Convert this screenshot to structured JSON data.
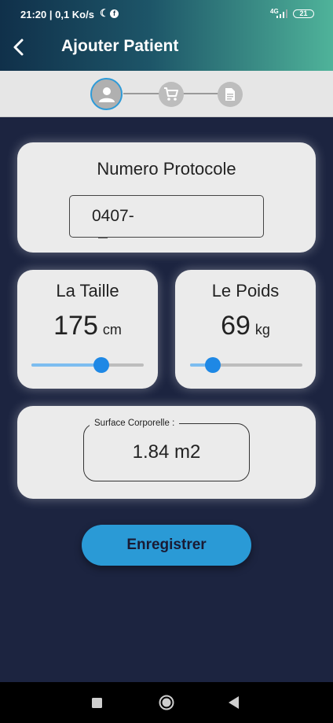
{
  "status_bar": {
    "time_and_speed": "21:20 | 0,1 Ko/s",
    "network": "4G",
    "battery": "21"
  },
  "app_bar": {
    "title": "Ajouter Patient",
    "back_icon": "arrow-back-icon"
  },
  "stepper": {
    "steps": [
      {
        "icon": "person-icon",
        "active": true
      },
      {
        "icon": "cart-icon",
        "active": false
      },
      {
        "icon": "document-icon",
        "active": false
      }
    ]
  },
  "protocol": {
    "title": "Numero Protocole",
    "value": "0407-"
  },
  "height": {
    "title": "La Taille",
    "value": "175",
    "unit": "cm",
    "slider_fraction": 0.62
  },
  "weight": {
    "title": "Le Poids",
    "value": "69",
    "unit": "kg",
    "slider_fraction": 0.2
  },
  "surface": {
    "label": "Surface Corporelle :",
    "value": "1.84 m2"
  },
  "save_button": {
    "label": "Enregistrer"
  },
  "nav_bar": {
    "buttons": [
      "recents-square-icon",
      "home-circle-icon",
      "back-triangle-icon"
    ]
  },
  "colors": {
    "background": "#1c2440",
    "accent": "#2a9ad6",
    "slider_thumb": "#1e88e5",
    "card": "#ebebeb"
  }
}
